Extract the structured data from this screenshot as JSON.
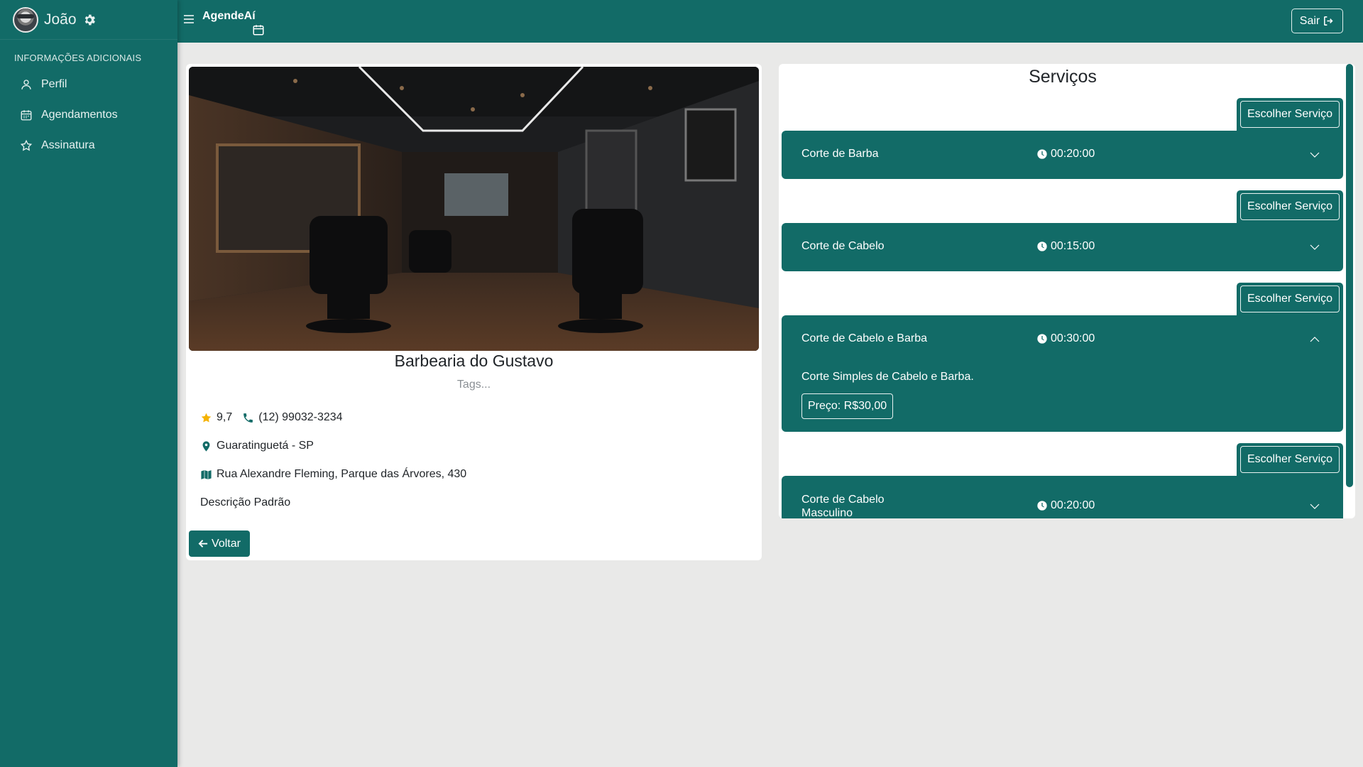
{
  "user": {
    "name": "João"
  },
  "sidebar": {
    "section_title": "INFORMAÇÕES ADICIONAIS",
    "items": [
      {
        "label": "Perfil",
        "icon": "user-icon"
      },
      {
        "label": "Agendamentos",
        "icon": "calendar-icon"
      },
      {
        "label": "Assinatura",
        "icon": "star-icon"
      }
    ]
  },
  "topbar": {
    "brand": "AgendeAí",
    "logout_label": "Sair"
  },
  "shop": {
    "name": "Barbearia do Gustavo",
    "tags_placeholder": "Tags...",
    "rating": "9,7",
    "phone": "(12) 99032-3234",
    "city": "Guaratinguetá - SP",
    "address": "Rua Alexandre Fleming, Parque das Árvores, 430",
    "description": "Descrição Padrão",
    "back_label": "Voltar"
  },
  "services": {
    "title": "Serviços",
    "choose_label": "Escolher Serviço",
    "items": [
      {
        "name": "Corte de Barba",
        "duration": "00:20:00",
        "expanded": false
      },
      {
        "name": "Corte de Cabelo",
        "duration": "00:15:00",
        "expanded": false
      },
      {
        "name": "Corte de Cabelo e Barba",
        "duration": "00:30:00",
        "expanded": true,
        "description": "Corte Simples de Cabelo e Barba.",
        "price": "Preço: R$30,00"
      },
      {
        "name_line1": "Corte de Cabelo",
        "name_line2": "Masculino",
        "duration": "00:20:00",
        "expanded": false
      }
    ]
  },
  "colors": {
    "primary": "#126b67",
    "background": "#e9e9e8",
    "star": "#f5b301"
  }
}
